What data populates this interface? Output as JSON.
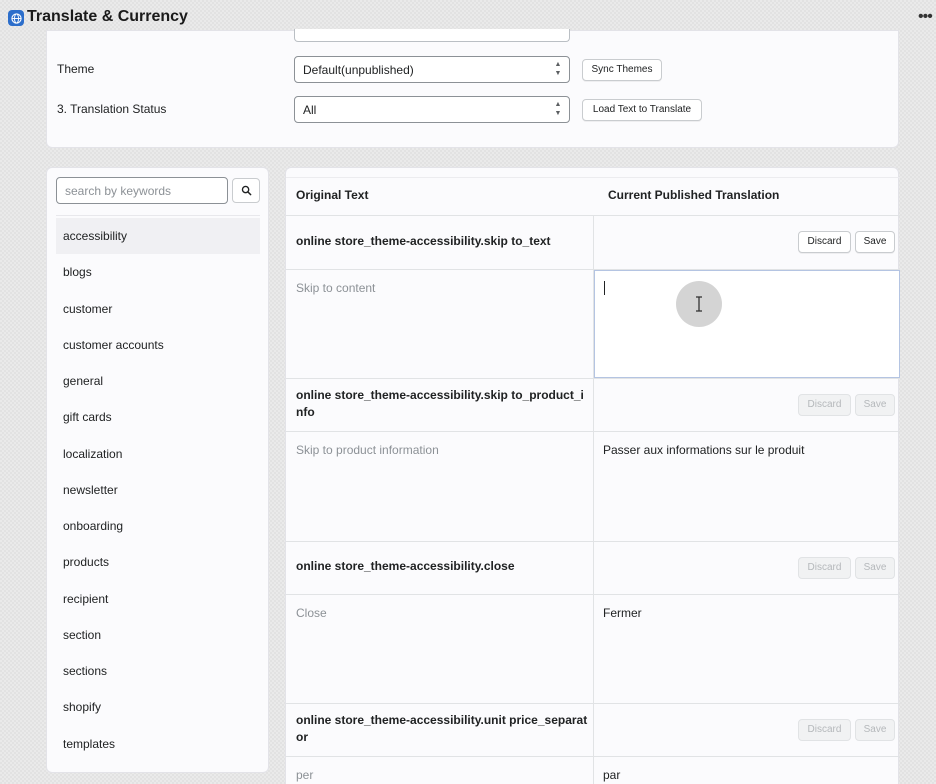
{
  "app": {
    "title": "Translate & Currency",
    "icon": "globe-icon",
    "menu_icon": "more-horizontal-icon"
  },
  "settings": {
    "theme_label": "Theme",
    "theme_value": "Default(unpublished)",
    "sync_themes_label": "Sync Themes",
    "status_label": "3. Translation Status",
    "status_value": "All",
    "load_text_label": "Load Text to Translate"
  },
  "sidebar": {
    "search_placeholder": "search by keywords",
    "search_icon": "search-icon",
    "items": [
      {
        "label": "accessibility",
        "active": true
      },
      {
        "label": "blogs"
      },
      {
        "label": "customer"
      },
      {
        "label": "customer accounts"
      },
      {
        "label": "general"
      },
      {
        "label": "gift cards"
      },
      {
        "label": "localization"
      },
      {
        "label": "newsletter"
      },
      {
        "label": "onboarding"
      },
      {
        "label": "products"
      },
      {
        "label": "recipient"
      },
      {
        "label": "section"
      },
      {
        "label": "sections"
      },
      {
        "label": "shopify"
      },
      {
        "label": "templates"
      }
    ]
  },
  "table": {
    "col_original": "Original Text",
    "col_translation": "Current Published Translation",
    "discard_label": "Discard",
    "save_label": "Save",
    "rows": [
      {
        "key": "online store_theme-accessibility.skip to_text",
        "original": "Skip to content",
        "translation": "",
        "editing": true,
        "actions_enabled": true
      },
      {
        "key": "online store_theme-accessibility.skip to_product_info",
        "original": "Skip to product information",
        "translation": "Passer aux informations sur le produit",
        "actions_enabled": false
      },
      {
        "key": "online store_theme-accessibility.close",
        "original": "Close",
        "translation": "Fermer",
        "actions_enabled": false
      },
      {
        "key": "online store_theme-accessibility.unit price_separator",
        "original": "per",
        "translation": "par",
        "actions_enabled": false
      }
    ]
  },
  "colors": {
    "accent": "#2c6ecb",
    "focus_border": "#b4c4e2"
  }
}
